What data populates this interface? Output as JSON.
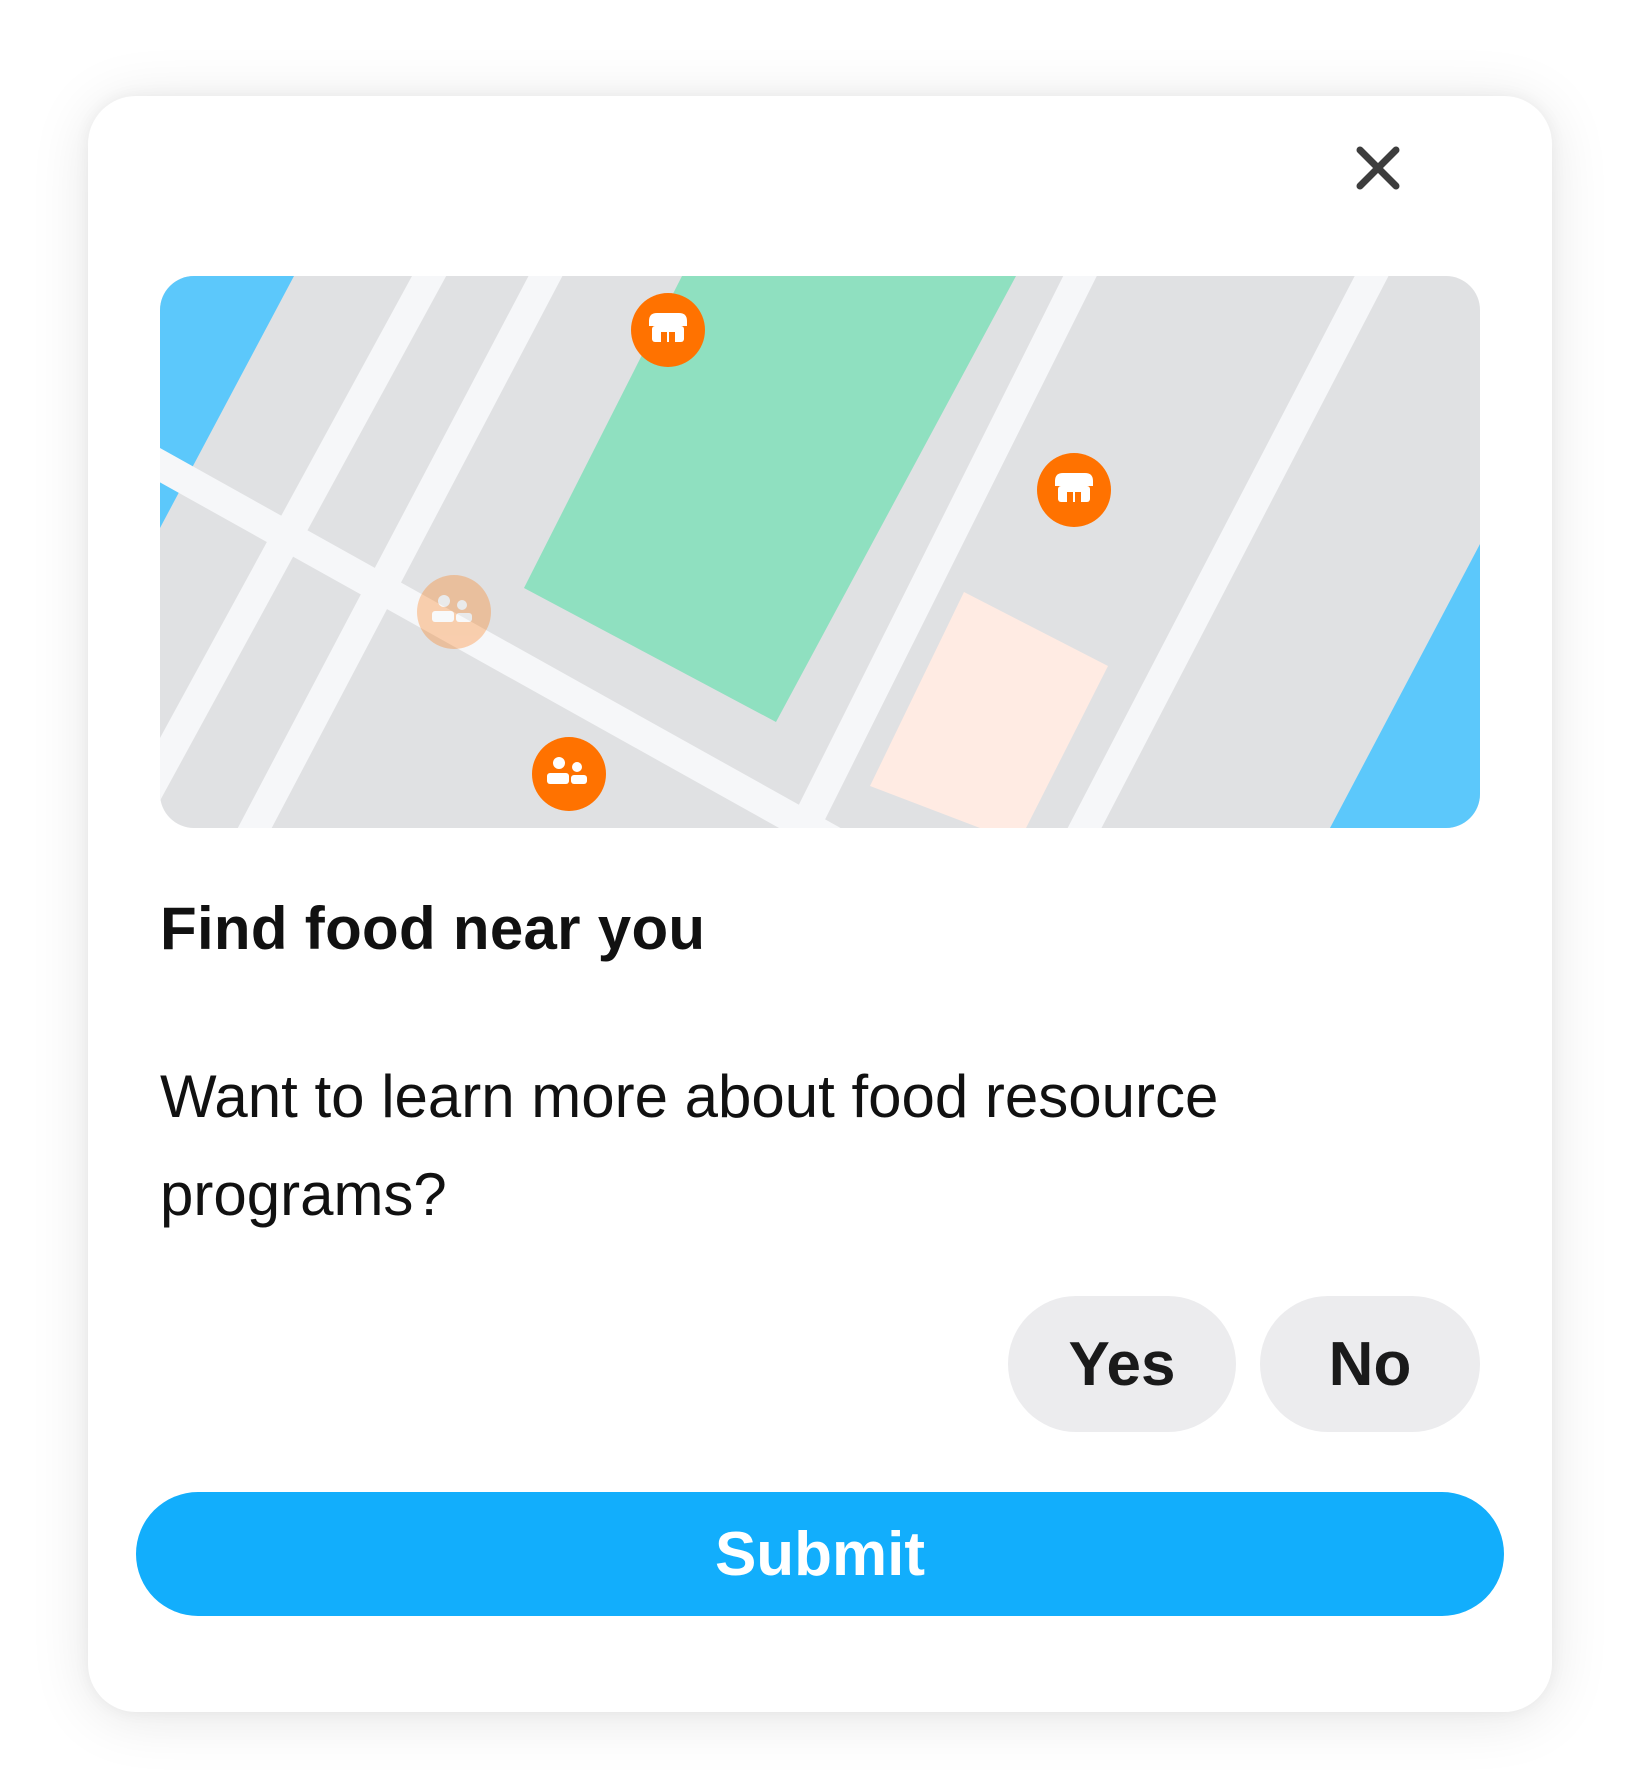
{
  "dialog": {
    "close_icon": "close-icon",
    "title": "Find food near you",
    "question": "Want to learn more about food resource programs?",
    "options": [
      {
        "label": "Yes"
      },
      {
        "label": "No"
      }
    ],
    "submit_label": "Submit"
  },
  "map": {
    "markers": [
      {
        "icon": "store-icon",
        "state": "active"
      },
      {
        "icon": "store-icon",
        "state": "active"
      },
      {
        "icon": "people-icon",
        "state": "faded"
      },
      {
        "icon": "people-icon",
        "state": "active"
      }
    ]
  },
  "colors": {
    "accent": "#12aefc",
    "marker": "#ff7200",
    "park": "#8fe0c0",
    "water": "#5cc8fb",
    "block": "#e0e1e3",
    "street": "#f6f7f9",
    "building": "#ffebe3",
    "option_bg": "#ececee"
  }
}
